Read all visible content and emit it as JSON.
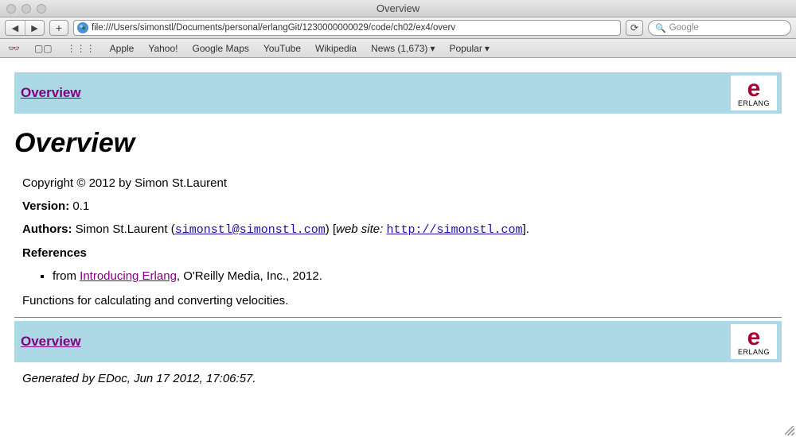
{
  "window": {
    "title": "Overview"
  },
  "url": "file:///Users/simonstl/Documents/personal/erlangGit/1230000000029/code/ch02/ex4/overv",
  "search": {
    "placeholder": "Google"
  },
  "bookmarks": [
    "Apple",
    "Yahoo!",
    "Google Maps",
    "YouTube",
    "Wikipedia",
    "News (1,673)",
    "Popular"
  ],
  "nav": {
    "overview": "Overview",
    "logoText": "ERLANG"
  },
  "page": {
    "heading": "Overview",
    "copyright": "Copyright © 2012 by Simon St.Laurent",
    "versionLabel": "Version:",
    "versionValue": "0.1",
    "authorsLabel": "Authors:",
    "authorName": "Simon St.Laurent",
    "authorEmail": "simonstl@simonstl.com",
    "webSiteLabel": "web site:",
    "webSiteUrl": "http://simonstl.com",
    "referencesHeading": "References",
    "refPrefix": "from ",
    "refLinkText": "Introducing Erlang",
    "refSuffix": ", O'Reilly Media, Inc., 2012.",
    "description": "Functions for calculating and converting velocities.",
    "generated": "Generated by EDoc, Jun 17 2012, 17:06:57."
  }
}
